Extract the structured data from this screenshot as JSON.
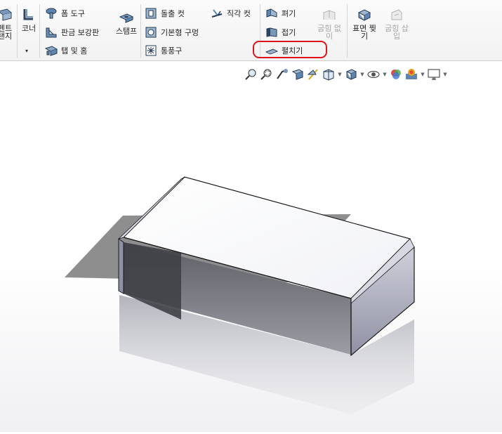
{
  "ribbon": {
    "left_cut": {
      "line1": "펜트",
      "line2": "탠지"
    },
    "corner": {
      "label": "코너"
    },
    "form_tool": {
      "label": "폼 도구"
    },
    "gusset": {
      "label": "판금 보강판"
    },
    "tab_slot": {
      "label": "탭 및 홈"
    },
    "stamp": {
      "label": "스탬프"
    },
    "extruded_cut": {
      "label": "돌출 컷"
    },
    "simple_hole": {
      "label": "기본형 구멍"
    },
    "vent": {
      "label": "통풍구"
    },
    "normal_cut": {
      "label": "직각 컷"
    },
    "unfold": {
      "label": "펴기"
    },
    "fold": {
      "label": "접기"
    },
    "flatten": {
      "label": "펼치기"
    },
    "no_bends": {
      "line1": "굽힘 없",
      "line2": "이"
    },
    "rip": {
      "line1": "표면 찢",
      "line2": "기"
    },
    "insert_bends": {
      "line1": "굽힘 삽",
      "line2": "입"
    }
  },
  "view_toolbar": {
    "icons": [
      "zoom-to-fit-icon",
      "zoom-to-area-icon",
      "previous-view-icon",
      "section-view-icon",
      "dynamic-annotation-icon",
      "view-orientation-icon",
      "display-style-icon",
      "hide-show-items-icon",
      "edit-appearance-icon",
      "apply-scene-icon",
      "view-settings-icon"
    ]
  },
  "colors": {
    "highlight": "#e0121b",
    "ribbon_bg": "#f5f5f5"
  }
}
